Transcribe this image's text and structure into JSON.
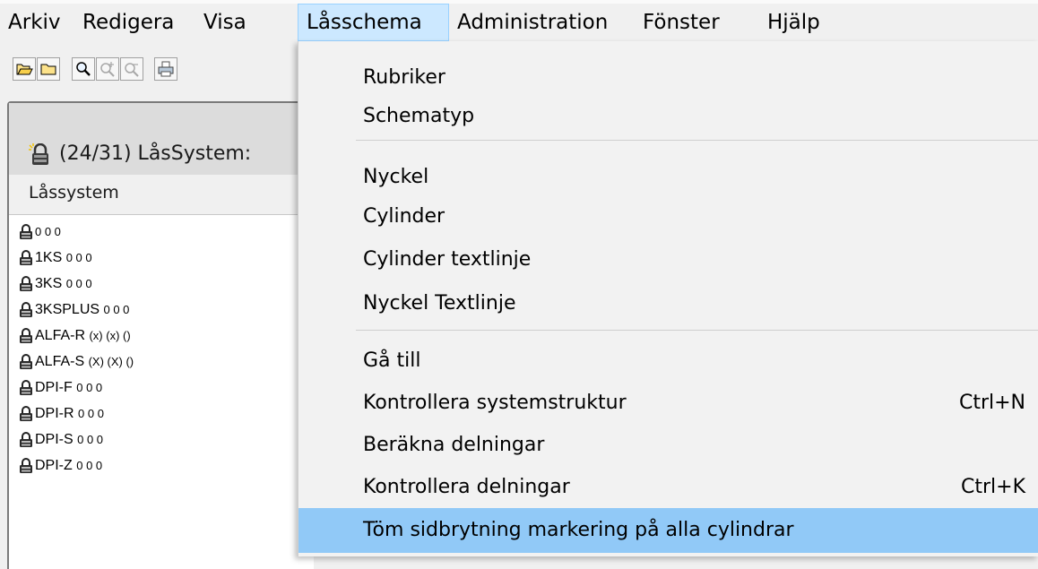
{
  "menubar": {
    "items": [
      {
        "label": "Arkiv"
      },
      {
        "label": "Redigera"
      },
      {
        "label": "Visa"
      },
      {
        "label": "Låsschema"
      },
      {
        "label": "Administration"
      },
      {
        "label": "Fönster"
      },
      {
        "label": "Hjälp"
      }
    ],
    "active_index": 3
  },
  "toolbar": {
    "buttons": [
      "open-folder-icon",
      "folder-icon",
      "zoom-icon",
      "zoom-in-icon",
      "zoom-out-icon",
      "print-icon"
    ]
  },
  "child_window": {
    "title": "(24/31) LåsSystem:",
    "column_header": "Låssystem",
    "rows": [
      {
        "name": "",
        "suffix": "0 0 0"
      },
      {
        "name": "1KS",
        "suffix": "0 0 0"
      },
      {
        "name": "3KS",
        "suffix": "0 0 0"
      },
      {
        "name": "3KSPLUS",
        "suffix": "0 0 0"
      },
      {
        "name": "ALFA-R",
        "suffix": "(x) (x) ()"
      },
      {
        "name": "ALFA-S",
        "suffix": "(X) (X) ()"
      },
      {
        "name": "DPI-F",
        "suffix": "0 0 0"
      },
      {
        "name": "DPI-R",
        "suffix": "0 0 0"
      },
      {
        "name": "DPI-S",
        "suffix": "0 0 0"
      },
      {
        "name": "DPI-Z",
        "suffix": "0 0 0"
      }
    ]
  },
  "dropdown": {
    "items": [
      {
        "label": "Rubriker",
        "submenu": true
      },
      {
        "label": "Schematyp",
        "submenu": true
      },
      {
        "label": "Nyckel",
        "submenu": true
      },
      {
        "label": "Cylinder",
        "submenu": true
      },
      {
        "label": "Cylinder textlinje",
        "submenu": true
      },
      {
        "label": "Nyckel Textlinje",
        "submenu": true
      },
      {
        "label": "Gå till",
        "submenu": true
      },
      {
        "label": "Kontrollera systemstruktur",
        "shortcut": "Ctrl+N"
      },
      {
        "label": "Beräkna delningar"
      },
      {
        "label": "Kontrollera delningar",
        "shortcut": "Ctrl+K"
      },
      {
        "label": "Töm sidbrytning markering på alla cylindrar",
        "highlighted": true
      }
    ],
    "submenu_arrow": "›"
  },
  "colors": {
    "menu_active_bg": "#cce8ff",
    "menu_active_border": "#99d1ff",
    "dropdown_highlight": "#91c9f7",
    "dropdown_bg": "#f2f2f2"
  }
}
